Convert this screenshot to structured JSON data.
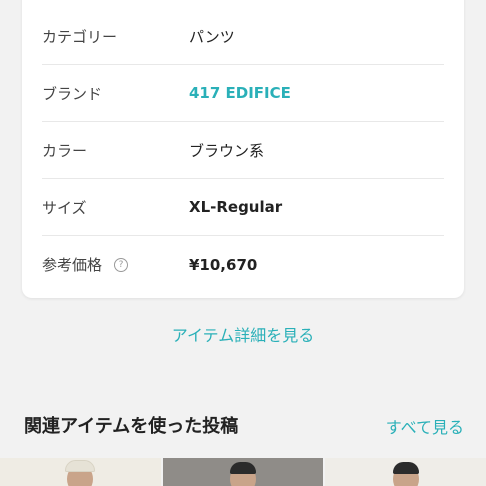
{
  "details": [
    {
      "label": "カテゴリー",
      "value": "パンツ",
      "style": "plain"
    },
    {
      "label": "ブランド",
      "value": "417 EDIFICE",
      "style": "link"
    },
    {
      "label": "カラー",
      "value": "ブラウン系",
      "style": "plain"
    },
    {
      "label": "サイズ",
      "value": "XL-Regular",
      "style": "bold"
    },
    {
      "label": "参考価格",
      "value": "¥10,670",
      "style": "bold",
      "help_icon": "?"
    }
  ],
  "item_detail_link": "アイテム詳細を見る",
  "related": {
    "title": "関連アイテムを使った投稿",
    "see_all": "すべて見る"
  },
  "colors": {
    "accent": "#2ab0b8"
  }
}
